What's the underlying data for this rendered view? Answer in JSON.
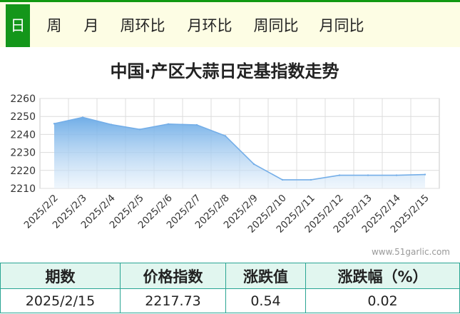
{
  "tabs": [
    {
      "label": "日",
      "active": true
    },
    {
      "label": "周",
      "active": false
    },
    {
      "label": "月",
      "active": false
    },
    {
      "label": "周环比",
      "active": false
    },
    {
      "label": "月环比",
      "active": false
    },
    {
      "label": "周同比",
      "active": false
    },
    {
      "label": "月同比",
      "active": false
    }
  ],
  "watermark": "www.51garlic.com",
  "colors": {
    "accent": "#14961a",
    "series_line": "#74aee8",
    "table_border": "#2aa593",
    "table_header_bg": "#e1f6ef"
  },
  "chart_data": {
    "type": "area",
    "title": "中国·产区大蒜日定基指数走势",
    "categories": [
      "2025/2/2",
      "2025/2/3",
      "2025/2/4",
      "2025/2/5",
      "2025/2/6",
      "2025/2/7",
      "2025/2/8",
      "2025/2/9",
      "2025/2/10",
      "2025/2/11",
      "2025/2/12",
      "2025/2/13",
      "2025/2/14",
      "2025/2/15"
    ],
    "values": [
      2246,
      2249.5,
      2245.5,
      2242.8,
      2245.8,
      2245.3,
      2239.2,
      2223.5,
      2214.8,
      2214.8,
      2217.3,
      2217.3,
      2217.3,
      2217.73
    ],
    "ylim": [
      2210,
      2260
    ],
    "yticks": [
      2210,
      2220,
      2230,
      2240,
      2250,
      2260
    ],
    "grid": true,
    "legend": "none"
  },
  "table": {
    "headers": [
      "期数",
      "价格指数",
      "涨跌值",
      "涨跌幅（%）"
    ],
    "rows": [
      [
        "2025/2/15",
        "2217.73",
        "0.54",
        "0.02"
      ]
    ]
  }
}
